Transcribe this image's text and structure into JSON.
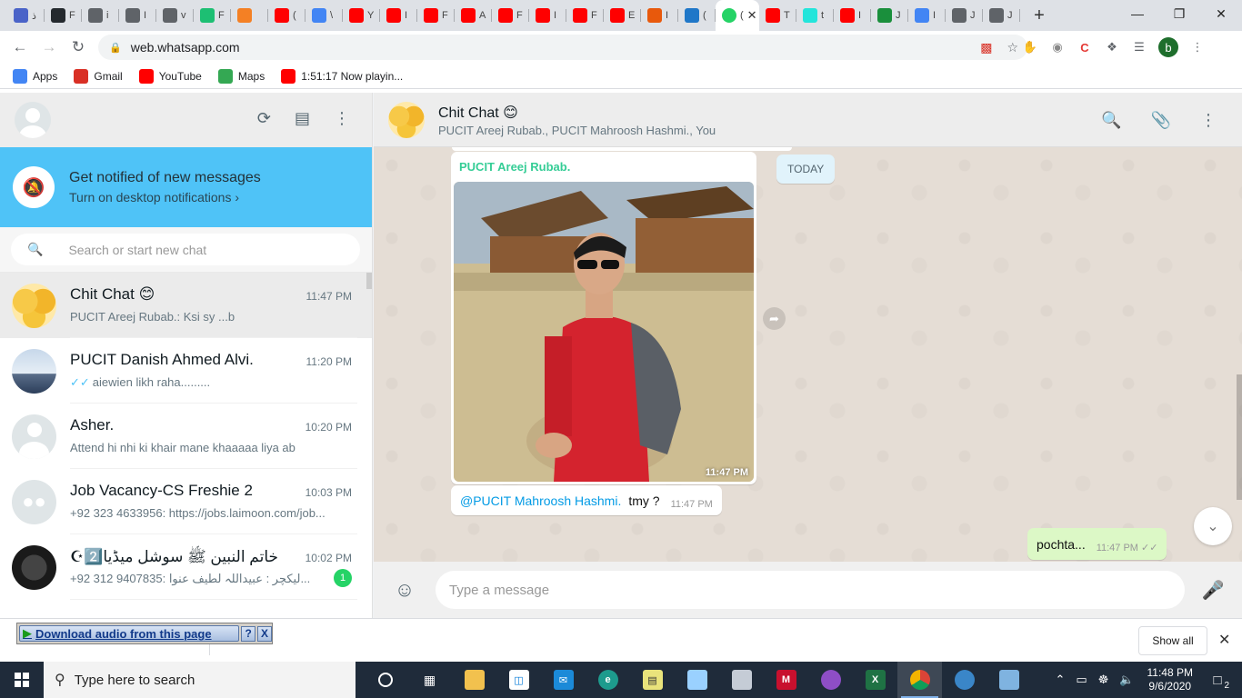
{
  "browser": {
    "tabs": [
      {
        "icon": "moon-icon",
        "color": "#4a63c8",
        "tail": "ذ"
      },
      {
        "icon": "github-icon",
        "color": "#24292e",
        "tail": "F"
      },
      {
        "icon": "globe-icon",
        "color": "#5f6368",
        "tail": "i"
      },
      {
        "icon": "globe-icon",
        "color": "#5f6368",
        "tail": "I"
      },
      {
        "icon": "globe-icon",
        "color": "#5f6368",
        "tail": "v"
      },
      {
        "icon": "fiverr-icon",
        "color": "#1dbf73",
        "tail": "F"
      },
      {
        "icon": "stackoverflow-icon",
        "color": "#f48024",
        "tail": ""
      },
      {
        "icon": "youtube-icon",
        "color": "#ff0000",
        "tail": "("
      },
      {
        "icon": "google-icon",
        "color": "#4285f4",
        "tail": "\\"
      },
      {
        "icon": "youtube-icon",
        "color": "#ff0000",
        "tail": "Y"
      },
      {
        "icon": "youtube-icon",
        "color": "#ff0000",
        "tail": "I"
      },
      {
        "icon": "youtube-icon",
        "color": "#ff0000",
        "tail": "F"
      },
      {
        "icon": "youtube-icon",
        "color": "#ff0000",
        "tail": "A"
      },
      {
        "icon": "youtube-icon",
        "color": "#ff0000",
        "tail": "F"
      },
      {
        "icon": "youtube-icon",
        "color": "#ff0000",
        "tail": "I"
      },
      {
        "icon": "youtube-icon",
        "color": "#ff0000",
        "tail": "F"
      },
      {
        "icon": "youtube-icon",
        "color": "#ff0000",
        "tail": "E"
      },
      {
        "icon": "two-icon",
        "color": "#e8590c",
        "tail": "I"
      },
      {
        "icon": "ct-icon",
        "color": "#1f77c8",
        "tail": "("
      }
    ],
    "tabs_after": [
      {
        "icon": "youtube-icon",
        "color": "#ff0000",
        "tail": "T"
      },
      {
        "icon": "olx-icon",
        "color": "#23e5db",
        "tail": "t"
      },
      {
        "icon": "youtube-icon",
        "color": "#ff0000",
        "tail": "I"
      },
      {
        "icon": "link-icon",
        "color": "#1a8f3c",
        "tail": "J"
      },
      {
        "icon": "google-icon",
        "color": "#4285f4",
        "tail": "I"
      },
      {
        "icon": "globe-icon",
        "color": "#5f6368",
        "tail": "J"
      },
      {
        "icon": "globe-icon",
        "color": "#5f6368",
        "tail": "J"
      }
    ],
    "active_tab_tail": "(",
    "url": "web.whatsapp.com",
    "bookmarks": [
      {
        "label": "Apps",
        "icon": "apps-grid-icon",
        "color": "#4285f4"
      },
      {
        "label": "Gmail",
        "icon": "gmail-icon",
        "color": "#d93025"
      },
      {
        "label": "YouTube",
        "icon": "youtube-icon",
        "color": "#ff0000"
      },
      {
        "label": "Maps",
        "icon": "maps-pin-icon",
        "color": "#34a853"
      },
      {
        "label": "1:51:17 Now playin...",
        "icon": "youtube-icon",
        "color": "#ff0000"
      }
    ],
    "profile_initial": "b"
  },
  "sidebar": {
    "notify_title": "Get notified of new messages",
    "notify_sub": "Turn on desktop notifications ›",
    "search_placeholder": "Search or start new chat",
    "chats": [
      {
        "name": "Chit Chat 😊",
        "time": "11:47 PM",
        "preview": "PUCIT Areej Rubab.: Ksi sy ...b",
        "avatar": "av-emoji",
        "ticks": "",
        "badge": "",
        "active": true
      },
      {
        "name": "PUCIT Danish Ahmed Alvi.",
        "time": "11:20 PM",
        "preview": "aiewien likh raha.........",
        "avatar": "av-danish",
        "ticks": "✓✓",
        "badge": "",
        "active": false
      },
      {
        "name": "Asher.",
        "time": "10:20 PM",
        "preview": "Attend hi nhi ki khair mane khaaaaa liya ab",
        "avatar": "av-default",
        "ticks": "",
        "badge": "",
        "active": false
      },
      {
        "name": "Job Vacancy-CS Freshie 2",
        "time": "10:03 PM",
        "preview": "+92 323 4633956: https://jobs.laimoon.com/job...",
        "avatar": "av-group",
        "ticks": "",
        "badge": "",
        "active": false
      },
      {
        "name": "☪خاتم النبین ﷺ سوشل میڈیا2️⃣",
        "time": "10:02 PM",
        "preview": "+92 312 9407835:  لیکچر : عبیداللہ لطیف عنوا...",
        "avatar": "av-dark",
        "ticks": "",
        "badge": "1",
        "active": false
      }
    ]
  },
  "conversation": {
    "title": "Chit Chat 😊",
    "members": "PUCIT Areej Rubab., PUCIT Mahroosh Hashmi., You",
    "date_chip": "TODAY",
    "image_message": {
      "sender": "PUCIT Areej Rubab.",
      "time": "11:47 PM"
    },
    "text_message": {
      "mention": "@PUCIT Mahroosh Hashmi.",
      "text": "tmy ?",
      "time": "11:47 PM"
    },
    "outgoing_message": {
      "text": "pochta...",
      "time": "11:47 PM"
    },
    "composer_placeholder": "Type a message"
  },
  "download_bar": {
    "popup_label": "Download audio from this page",
    "help": "?",
    "close": "X",
    "show_all": "Show all"
  },
  "taskbar": {
    "search_placeholder": "Type here to search",
    "time": "11:48 PM",
    "date": "9/6/2020",
    "notifications": "2"
  }
}
